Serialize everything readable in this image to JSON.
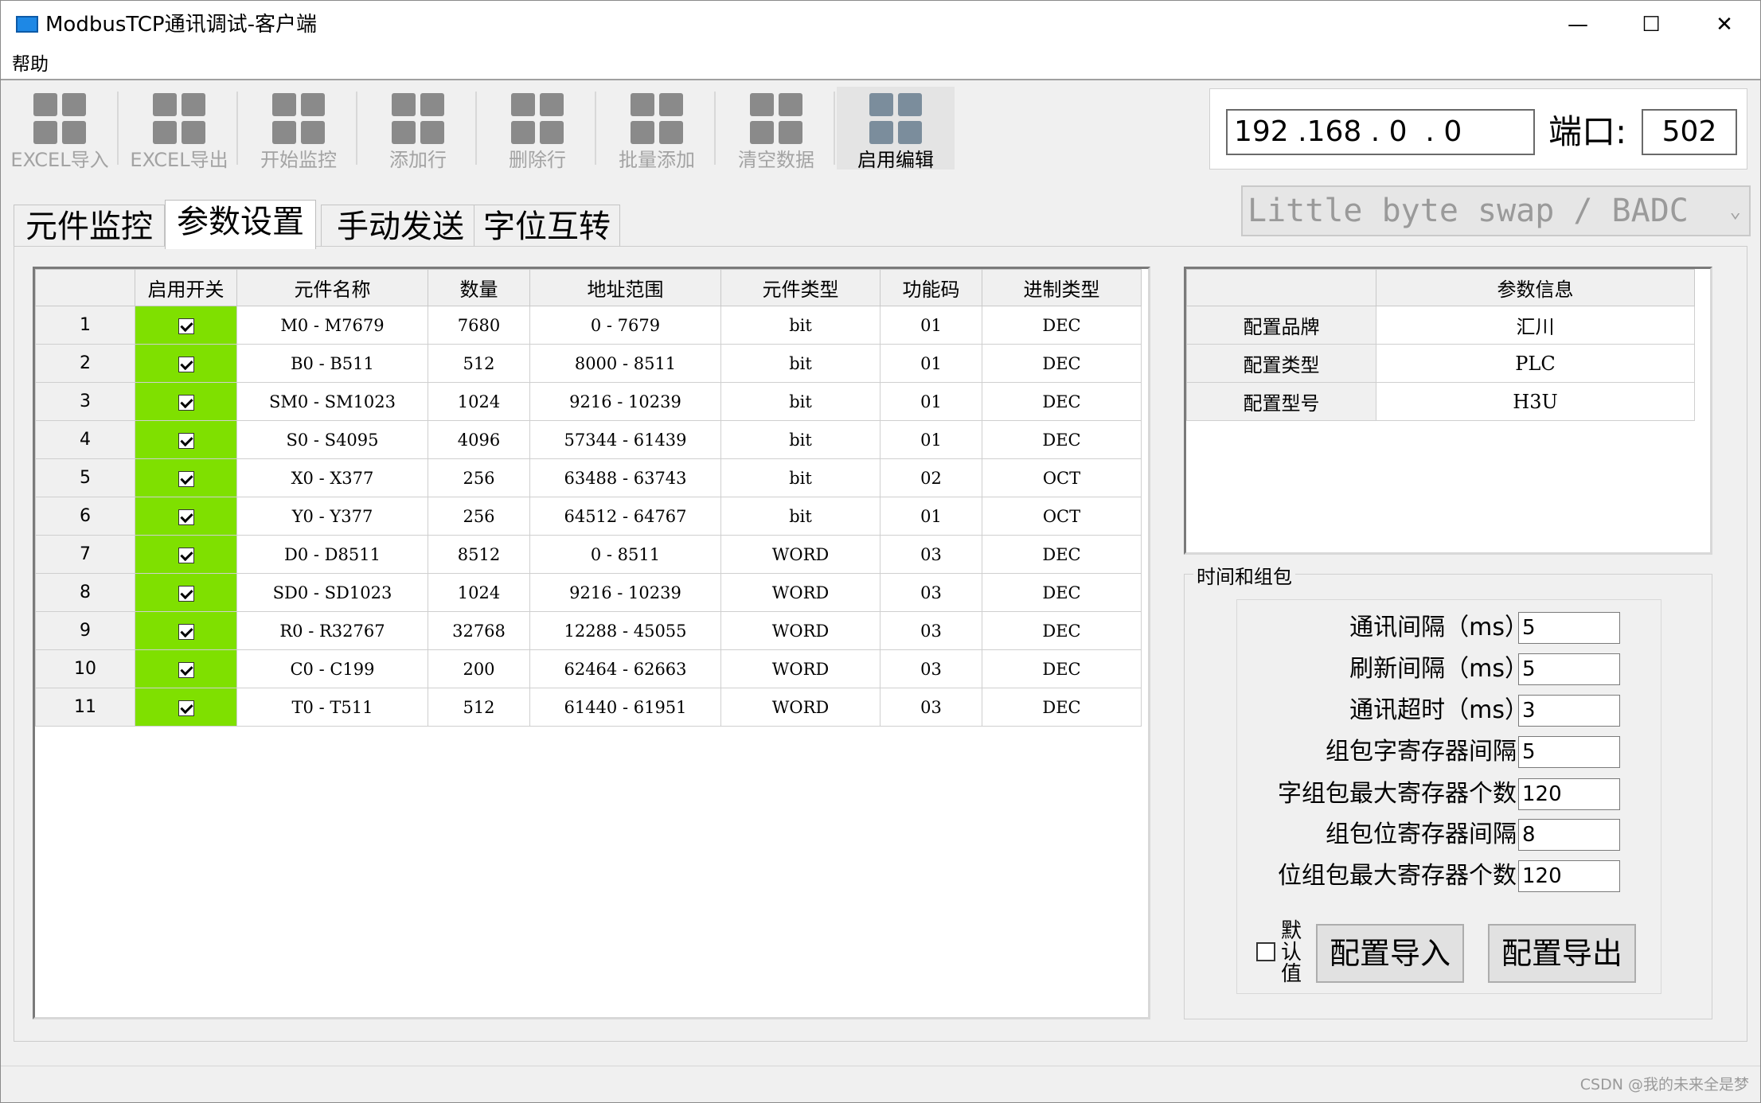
{
  "window": {
    "title": "ModbusTCP通讯调试-客户端",
    "minimize_glyph": "—",
    "maximize_glyph": "☐",
    "close_glyph": "✕"
  },
  "menu": {
    "help": "帮助"
  },
  "toolbar": {
    "buttons": [
      {
        "label": "EXCEL导入",
        "icon": "grid-icon"
      },
      {
        "label": "EXCEL导出",
        "icon": "grid-icon"
      },
      {
        "label": "开始监控",
        "icon": "grid-icon"
      },
      {
        "label": "添加行",
        "icon": "grid-icon"
      },
      {
        "label": "删除行",
        "icon": "grid-icon"
      },
      {
        "label": "批量添加",
        "icon": "grid-icon"
      },
      {
        "label": "清空数据",
        "icon": "grid-icon"
      },
      {
        "label": "启用编辑",
        "icon": "grid-icon"
      }
    ]
  },
  "connection": {
    "ip": "192 .168 . 0  . 0",
    "port_label": "端口:",
    "port": "502"
  },
  "byte_order": {
    "selected": "Little byte swap / BADC",
    "chevron": "⌄"
  },
  "tabs": [
    "元件监控",
    "参数设置",
    "手动发送",
    "字位互转"
  ],
  "selected_tab": "参数设置",
  "main_table": {
    "headers": [
      "",
      "启用开关",
      "元件名称",
      "数量",
      "地址范围",
      "元件类型",
      "功能码",
      "进制类型"
    ],
    "rows": [
      {
        "no": "1",
        "enabled": true,
        "name": "M0 - M7679",
        "count": "7680",
        "range": "0 - 7679",
        "type": "bit",
        "func": "01",
        "base": "DEC"
      },
      {
        "no": "2",
        "enabled": true,
        "name": "B0 - B511",
        "count": "512",
        "range": "8000 - 8511",
        "type": "bit",
        "func": "01",
        "base": "DEC"
      },
      {
        "no": "3",
        "enabled": true,
        "name": "SM0 - SM1023",
        "count": "1024",
        "range": "9216 - 10239",
        "type": "bit",
        "func": "01",
        "base": "DEC"
      },
      {
        "no": "4",
        "enabled": true,
        "name": "S0 - S4095",
        "count": "4096",
        "range": "57344 - 61439",
        "type": "bit",
        "func": "01",
        "base": "DEC"
      },
      {
        "no": "5",
        "enabled": true,
        "name": "X0 - X377",
        "count": "256",
        "range": "63488 - 63743",
        "type": "bit",
        "func": "02",
        "base": "OCT"
      },
      {
        "no": "6",
        "enabled": true,
        "name": "Y0 - Y377",
        "count": "256",
        "range": "64512 - 64767",
        "type": "bit",
        "func": "01",
        "base": "OCT"
      },
      {
        "no": "7",
        "enabled": true,
        "name": "D0 - D8511",
        "count": "8512",
        "range": "0 - 8511",
        "type": "WORD",
        "func": "03",
        "base": "DEC"
      },
      {
        "no": "8",
        "enabled": true,
        "name": "SD0 - SD1023",
        "count": "1024",
        "range": "9216 - 10239",
        "type": "WORD",
        "func": "03",
        "base": "DEC"
      },
      {
        "no": "9",
        "enabled": true,
        "name": "R0 - R32767",
        "count": "32768",
        "range": "12288 - 45055",
        "type": "WORD",
        "func": "03",
        "base": "DEC"
      },
      {
        "no": "10",
        "enabled": true,
        "name": "C0 - C199",
        "count": "200",
        "range": "62464 - 62663",
        "type": "WORD",
        "func": "03",
        "base": "DEC"
      },
      {
        "no": "11",
        "enabled": true,
        "name": "T0 - T511",
        "count": "512",
        "range": "61440 - 61951",
        "type": "WORD",
        "func": "03",
        "base": "DEC"
      }
    ],
    "enabled_color": "#7fe000"
  },
  "info_table": {
    "headers": [
      "",
      "参数信息"
    ],
    "rows": [
      {
        "key": "配置品牌",
        "value": "汇川"
      },
      {
        "key": "配置类型",
        "value": "PLC"
      },
      {
        "key": "配置型号",
        "value": "H3U"
      }
    ]
  },
  "timing": {
    "title": "时间和组包",
    "fields": [
      {
        "label": "通讯间隔（ms）：",
        "value": "5"
      },
      {
        "label": "刷新间隔（ms）：",
        "value": "5"
      },
      {
        "label": "通讯超时（ms）：",
        "value": "3"
      },
      {
        "label": "组包字寄存器间隔：",
        "value": "5"
      },
      {
        "label": "字组包最大寄存器个数：",
        "value": "120"
      },
      {
        "label": "组包位寄存器间隔：",
        "value": "8"
      },
      {
        "label": "位组包最大寄存器个数：",
        "value": "120"
      }
    ],
    "default_label": "默认值",
    "default_checked": false,
    "import_label": "配置导入",
    "export_label": "配置导出"
  },
  "watermark": "CSDN @我的未来全是梦"
}
